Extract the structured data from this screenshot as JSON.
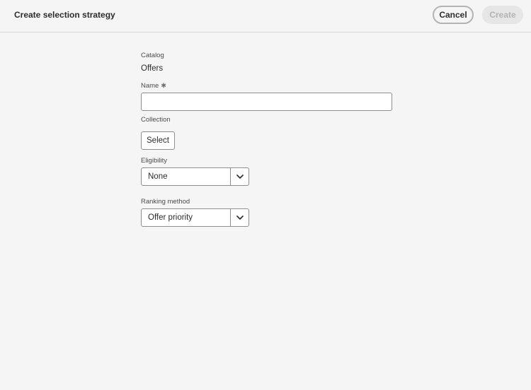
{
  "header": {
    "title": "Create selection strategy",
    "cancel_label": "Cancel",
    "create_label": "Create"
  },
  "form": {
    "catalog": {
      "label": "Catalog",
      "value": "Offers"
    },
    "name": {
      "label": "Name",
      "required_mark": "✱",
      "value": ""
    },
    "collection": {
      "label": "Collection",
      "button_label": "Select"
    },
    "eligibility": {
      "label": "Eligibility",
      "selected": "None"
    },
    "ranking": {
      "label": "Ranking method",
      "selected": "Offer priority"
    }
  },
  "icons": {
    "dropdown": "chevron-down-icon"
  },
  "colors": {
    "background": "#f5f5f5",
    "disabled_button_bg": "#e6e6e6",
    "disabled_button_text": "#b3b3b3",
    "field_border": "#8e8e8e"
  }
}
